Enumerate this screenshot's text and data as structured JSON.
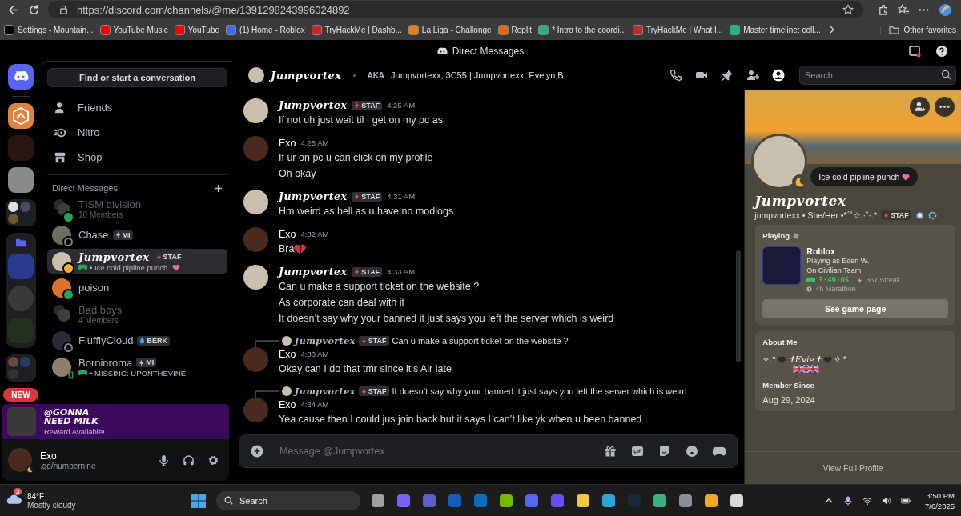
{
  "browser": {
    "url": "https://discord.com/channels/@me/1391298243996024892",
    "bookmarks": [
      {
        "label": "Settings - Mountain...",
        "color": "#000000"
      },
      {
        "label": "YouTube Music",
        "color": "#ff0000"
      },
      {
        "label": "YouTube",
        "color": "#ff0000"
      },
      {
        "label": "(1) Home - Roblox",
        "color": "#3a6df0"
      },
      {
        "label": "TryHackMe | Dashb...",
        "color": "#c62828"
      },
      {
        "label": "La Liga - Challonge",
        "color": "#f57c00"
      },
      {
        "label": "Replit",
        "color": "#f26207"
      },
      {
        "label": "* Intro to the coordi...",
        "color": "#1eb980"
      },
      {
        "label": "TryHackMe | What I...",
        "color": "#c62828"
      },
      {
        "label": "Master timeline: coll...",
        "color": "#1eb980"
      }
    ],
    "other_favorites": "Other favorites"
  },
  "app": {
    "title": "Direct Messages"
  },
  "servers": {
    "new_badge": "NEW"
  },
  "dm_panel": {
    "search": "Find or start a conversation",
    "nav": [
      {
        "label": "Friends",
        "kind": "friends"
      },
      {
        "label": "Nitro",
        "kind": "nitro"
      },
      {
        "label": "Shop",
        "kind": "shop"
      }
    ],
    "section": "Direct Messages",
    "conversations": [
      {
        "name": "TISM division",
        "kind": "group",
        "muted": true,
        "script": false,
        "subtitle": "10 Members",
        "status": {
          "kind": "online"
        },
        "selected": false
      },
      {
        "name": "Chase",
        "kind": "user",
        "muted": false,
        "script": false,
        "tag": {
          "label": "MI",
          "kind": "bolt"
        },
        "status": {
          "kind": "offline"
        },
        "selected": false
      },
      {
        "name": "Jumpvortex",
        "kind": "user",
        "muted": false,
        "script": true,
        "tag": {
          "label": "STAF",
          "kind": "bolt"
        },
        "activity": "• Ice cold pipline punch",
        "emoji": {
          "kind": "heart"
        },
        "status": {
          "kind": "idle"
        },
        "selected": true
      },
      {
        "name": "poison",
        "kind": "user",
        "muted": false,
        "script": false,
        "status": {
          "kind": "online"
        },
        "selected": false
      },
      {
        "name": "Bad boys",
        "kind": "group",
        "muted": true,
        "script": false,
        "subtitle": "4 Members",
        "selected": false
      },
      {
        "name": "FlufflyCloud",
        "kind": "user",
        "muted": false,
        "script": false,
        "tag": {
          "label": "BERK",
          "kind": "drop"
        },
        "status": {
          "kind": "offline"
        },
        "selected": false
      },
      {
        "name": "Borninroma",
        "kind": "user",
        "muted": false,
        "script": false,
        "tag": {
          "label": "MI",
          "kind": "bolt"
        },
        "activity": "• MISSING: UPONTHEVINE",
        "status": {
          "kind": "mobile"
        },
        "selected": false
      }
    ]
  },
  "promo": {
    "title_lines": [
      "@GONNA",
      "NEED MILK"
    ],
    "subtitle": "Reward Available!"
  },
  "user_panel": {
    "name": "Exo",
    "status": ".gg/numbernine"
  },
  "chat": {
    "header": {
      "name": "Jumpvortex",
      "separator": "•",
      "aka_label": "AKA",
      "aka": "Jumpvortexx, 3C55 | Jumpvortexx, Evelyn B.",
      "search_placeholder": "Search"
    },
    "messages": [
      {
        "author": "Jumpvortex",
        "script": true,
        "tag": "STAF",
        "time": "4:25 AM",
        "lines": [
          "If not uh just wait til I get on my pc as"
        ]
      },
      {
        "author": "Exo",
        "script": false,
        "time": "4:25 AM",
        "lines": [
          "If ur on pc u can click on my profile",
          "Oh okay"
        ]
      },
      {
        "author": "Jumpvortex",
        "script": true,
        "tag": "STAF",
        "time": "4:31 AM",
        "lines": [
          "Hm weird as hell as u have no modlogs"
        ]
      },
      {
        "author": "Exo",
        "script": false,
        "time": "4:32 AM",
        "lines": [
          "Bra"
        ],
        "emoji": {
          "kind": "broken_heart"
        }
      },
      {
        "author": "Jumpvortex",
        "script": true,
        "tag": "STAF",
        "time": "4:33 AM",
        "lines": [
          "Can u make a support ticket on the website ?",
          "As corporate can deal with it",
          "It doesn’t say why your banned it just says you left the server which is weird"
        ]
      },
      {
        "reply": {
          "author": "Jumpvortex",
          "tag": "STAF",
          "text": "Can u make a support ticket on the website ?"
        },
        "author": "Exo",
        "script": false,
        "time": "4:33 AM",
        "lines": [
          "Okay can I do that tmr since it’s Alr late"
        ]
      },
      {
        "reply": {
          "author": "Jumpvortex",
          "tag": "STAF",
          "text": "It doesn’t say why your banned it just says you left the server which is weird"
        },
        "author": "Exo",
        "script": false,
        "time": "4:34 AM",
        "lines": [
          "Yea cause then I could jus join back but it says I can’t like yk when u been banned"
        ]
      }
    ],
    "composer": {
      "placeholder": "Message @Jumpvortex"
    }
  },
  "profile": {
    "status_bubble": "Ice cold pipline punch",
    "status_emoji": {
      "kind": "heart"
    },
    "display_name": "Jumpvortex",
    "username_line": "jumpvortexx • She/Her •*ˊ˚☆.·˚·.*",
    "tag": "STAF",
    "activity": {
      "label": "Playing",
      "game": "Roblox",
      "details": [
        "Playing as Eden W.",
        "On Civilian Team"
      ],
      "timer": "3:49:05",
      "streak": "36x Streak",
      "marathon": "4h Marathon",
      "button": "See game page"
    },
    "about": {
      "label": "About Me",
      "parts": [
        {
          "kind": "text",
          "text": "✧.*"
        },
        {
          "kind": "black_heart"
        },
        {
          "kind": "text",
          "text": "✝Evie✝"
        },
        {
          "kind": "black_heart"
        },
        {
          "kind": "text",
          "text": "✧.*"
        }
      ],
      "member_label": "Member Since",
      "member_since": "Aug 29, 2024"
    },
    "footer": "View Full Profile"
  },
  "taskbar": {
    "weather_badge": "3",
    "temperature": "84°F",
    "weather": "Mostly cloudy",
    "search": "Search",
    "apps": [
      {
        "color": "#9e9e9e"
      },
      {
        "color": "#7b61ff"
      },
      {
        "color": "#5b5fc7"
      },
      {
        "color": "#185abd"
      },
      {
        "color": "#0f6cbd"
      },
      {
        "color": "#76b900"
      },
      {
        "color": "#5865f2"
      },
      {
        "color": "#6c4cf5"
      },
      {
        "color": "#f2c744"
      },
      {
        "color": "#2fa4d9"
      },
      {
        "color": "#1b2838"
      },
      {
        "color": "#36b37e"
      },
      {
        "color": "#8a8f98"
      },
      {
        "color": "#f5a623"
      },
      {
        "color": "#d8d8d8"
      }
    ],
    "time": "3:50 PM",
    "date": "7/6/2025"
  }
}
